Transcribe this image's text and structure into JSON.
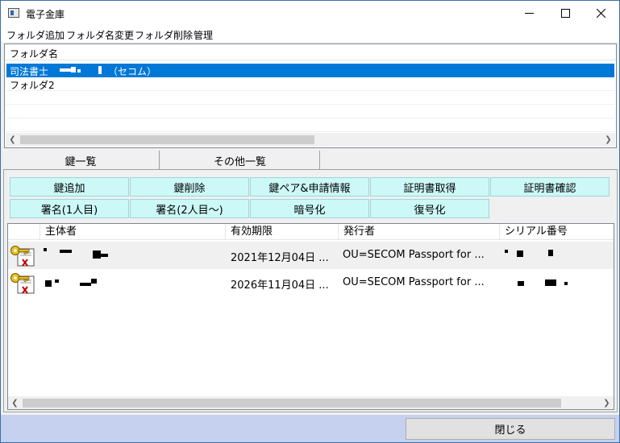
{
  "window": {
    "title": "電子金庫",
    "controls": [
      "minimize",
      "maximize",
      "close"
    ]
  },
  "menu": [
    "フォルダ追加",
    "フォルダ名変更",
    "フォルダ削除",
    "管理"
  ],
  "folders": {
    "header": "フォルダ名",
    "items": [
      {
        "prefix": "司法書士",
        "suffix": "（セコム）",
        "selected": true
      },
      {
        "prefix": "フォルダ2",
        "suffix": "",
        "selected": false
      }
    ]
  },
  "tabs": [
    {
      "label": "鍵一覧",
      "active": true
    },
    {
      "label": "その他一覧",
      "active": false
    }
  ],
  "key_buttons": {
    "row1": [
      "鍵追加",
      "鍵削除",
      "鍵ペア&申請情報",
      "証明書取得",
      "証明書確認"
    ],
    "row2": [
      "署名(1人目)",
      "署名(2人目〜)",
      "暗号化",
      "復号化"
    ]
  },
  "cert_table": {
    "columns": [
      "主体者",
      "有効期限",
      "発行者",
      "シリアル番号"
    ],
    "rows": [
      {
        "subject": "",
        "expiry": "2021年12月04日 ...",
        "issuer": "OU=SECOM Passport for ...",
        "serial": ""
      },
      {
        "subject": "",
        "expiry": "2026年11月04日 ...",
        "issuer": "OU=SECOM Passport for ...",
        "serial": ""
      }
    ]
  },
  "footer": {
    "close_label": "閉じる"
  },
  "colors": {
    "selection": "#0078d7",
    "key_button_bg": "#ccf8f8",
    "footer_bg": "#c5d1ee"
  }
}
